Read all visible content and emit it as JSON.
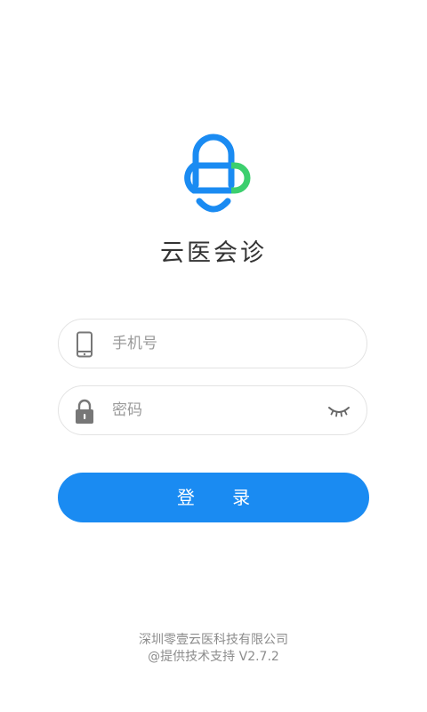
{
  "app": {
    "title": "云医会诊"
  },
  "login_form": {
    "phone": {
      "value": "",
      "placeholder": "手机号",
      "icon": "phone-icon"
    },
    "password": {
      "value": "",
      "placeholder": "密码",
      "icon": "lock-icon",
      "toggle_icon": "eye-closed-icon"
    },
    "submit_label": "登 录"
  },
  "footer": {
    "company": "深圳零壹云医科技有限公司",
    "support": "@提供技术支持 V2.7.2"
  },
  "colors": {
    "brand_blue": "#1a8bf2",
    "brand_green": "#3ccf6e",
    "text_dark": "#333333",
    "text_muted": "#8c8c8c"
  }
}
